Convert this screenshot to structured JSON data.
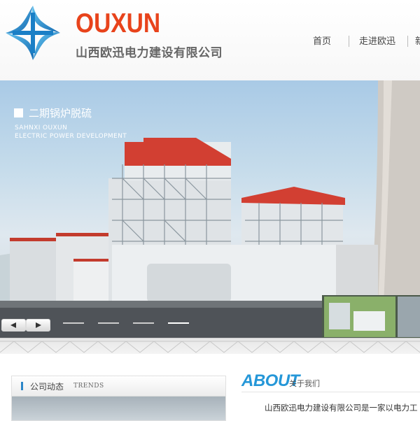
{
  "header": {
    "brand_en": "OUXUN",
    "brand_cn": "山西欧迅电力建设有限公司"
  },
  "nav": {
    "items": [
      {
        "label": "首页"
      },
      {
        "label": "走进欧迅"
      },
      {
        "label": "新"
      }
    ]
  },
  "banner": {
    "title": "二期锅炉脱硫",
    "subtitle_line1": "SAHNXI OUXUN",
    "subtitle_line2": "ELECTRIC POWER DEVELOPMENT",
    "active_slide": 3,
    "slide_count": 4
  },
  "news": {
    "title": "公司动态",
    "tag": "TRENDS"
  },
  "about": {
    "heading_en": "ABOUT",
    "heading_cn": "关于我们",
    "text": "山西欧迅电力建设有限公司是一家以电力工"
  },
  "colors": {
    "brand": "#e8431b",
    "accent": "#2597d8",
    "logo_blue": "#1a7fc6"
  }
}
